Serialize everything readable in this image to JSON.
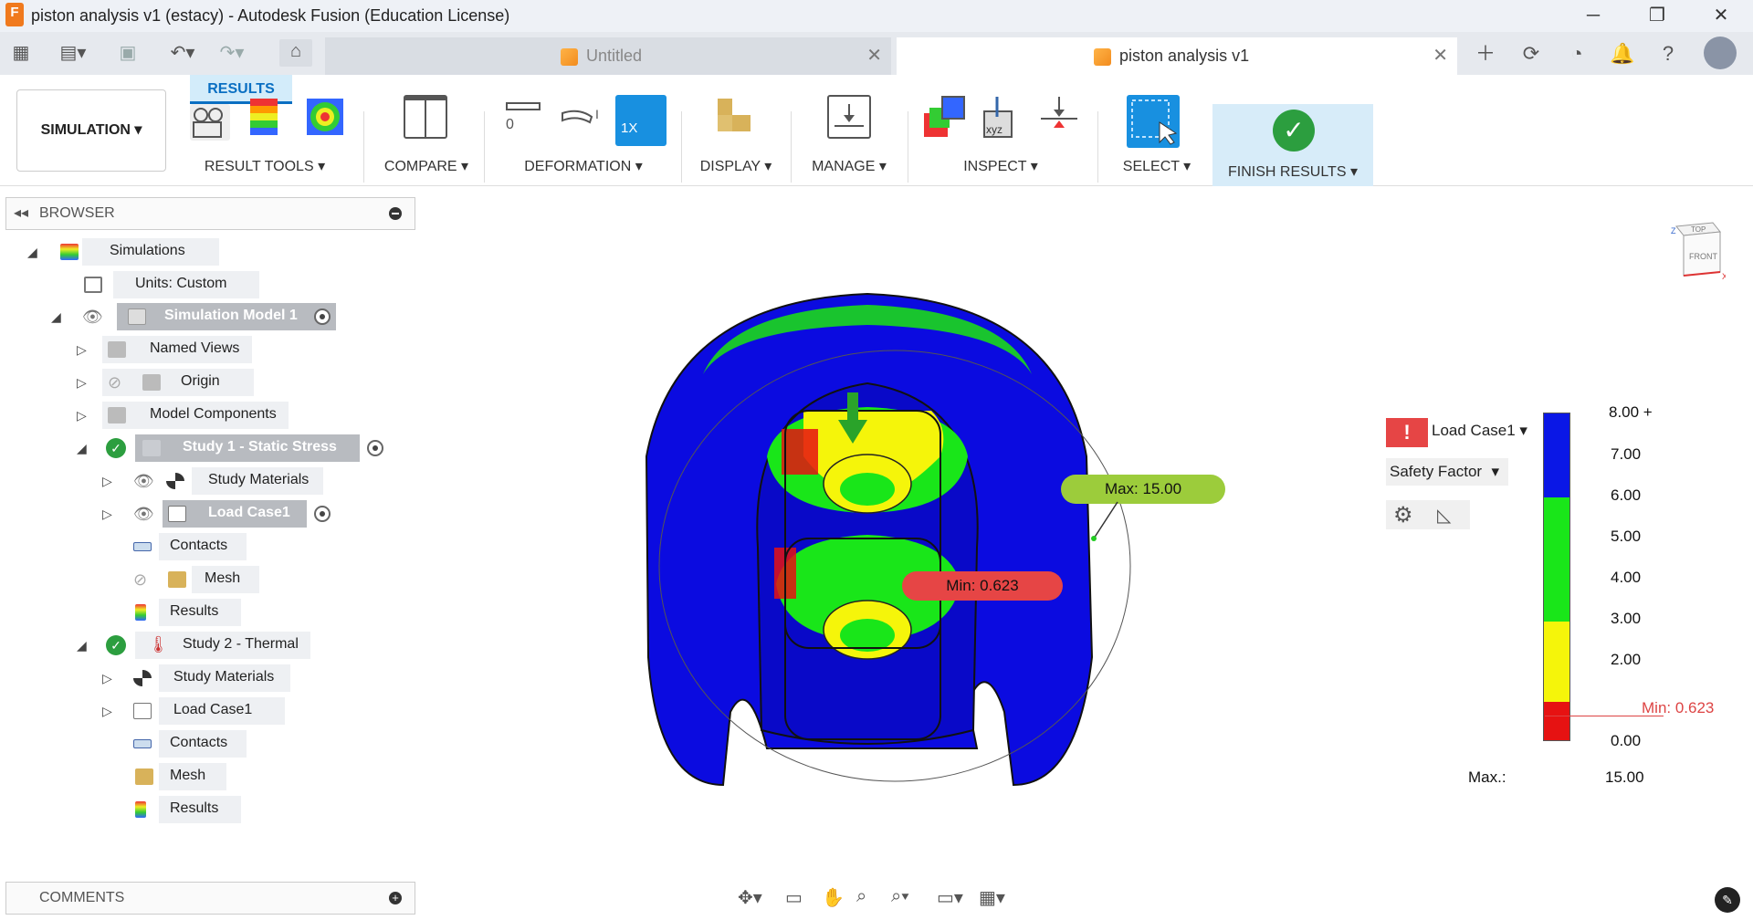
{
  "window": {
    "title": "piston analysis v1 (estacy) - Autodesk Fusion (Education License)",
    "logo": "F",
    "minimize": "─",
    "restore": "❐",
    "close": "✕"
  },
  "tabs": [
    {
      "label": "Untitled",
      "active": false
    },
    {
      "label": "piston analysis v1",
      "active": true
    }
  ],
  "ribbon": {
    "workspace": "SIMULATION",
    "active_tab": "RESULTS",
    "groups": [
      "RESULT TOOLS",
      "COMPARE",
      "DEFORMATION",
      "DISPLAY",
      "MANAGE",
      "INSPECT",
      "SELECT",
      "FINISH RESULTS"
    ],
    "deformation_scale": "1X",
    "deformation_zero": "0",
    "inspect_xyz": "xyz"
  },
  "browser": {
    "title": "BROWSER",
    "tree": [
      {
        "label": "Simulations"
      },
      {
        "label": "Units: Custom"
      },
      {
        "label": "Simulation Model 1"
      },
      {
        "label": "Named Views"
      },
      {
        "label": "Origin"
      },
      {
        "label": "Model Components"
      },
      {
        "label": "Study 1 - Static Stress"
      },
      {
        "label": "Study Materials"
      },
      {
        "label": "Load Case1"
      },
      {
        "label": "Contacts"
      },
      {
        "label": "Mesh"
      },
      {
        "label": "Results"
      },
      {
        "label": "Study 2 - Thermal"
      },
      {
        "label": "Study Materials"
      },
      {
        "label": "Load Case1"
      },
      {
        "label": "Contacts"
      },
      {
        "label": "Mesh"
      },
      {
        "label": "Results"
      }
    ]
  },
  "comments": {
    "title": "COMMENTS"
  },
  "viewcube": {
    "top": "TOP",
    "front": "FRONT",
    "x": "X",
    "z": "Z"
  },
  "results_panel": {
    "load_case": "Load Case1",
    "result_type": "Safety Factor",
    "legend": [
      "8.00 +",
      "7.00",
      "6.00",
      "5.00",
      "4.00",
      "3.00",
      "2.00",
      "0.00"
    ],
    "min_label": "Min: 0.623",
    "max_label": "Max.:",
    "max_value": "15.00",
    "colors": {
      "blue": "#0a17e6",
      "green": "#19e619",
      "yellow": "#f5f50a",
      "red": "#e61212"
    }
  },
  "model": {
    "max_tag": "Max: 15.00",
    "min_tag": "Min: 0.623"
  }
}
